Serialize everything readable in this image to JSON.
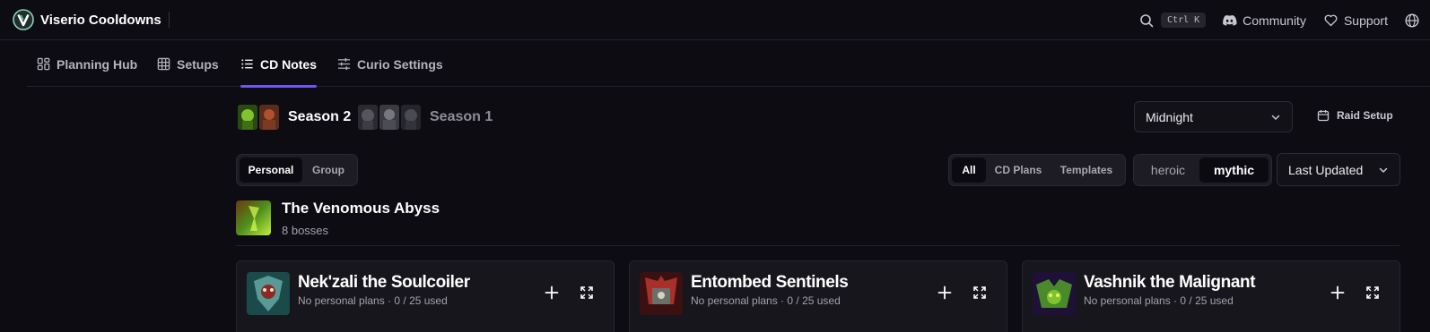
{
  "app": {
    "name": "Viserio Cooldowns",
    "search_shortcut": "Ctrl K",
    "links": [
      {
        "label": "Community",
        "icon": "discord-icon"
      },
      {
        "label": "Support",
        "icon": "heart-icon"
      }
    ],
    "language_icon": "globe-icon",
    "accent": "#6d57f0"
  },
  "nav": {
    "tabs": [
      {
        "label": "Planning Hub",
        "icon": "dashboard-icon",
        "active": false
      },
      {
        "label": "Setups",
        "icon": "grid-icon",
        "active": false
      },
      {
        "label": "CD Notes",
        "icon": "list-icon",
        "active": true
      },
      {
        "label": "Curio Settings",
        "icon": "sliders-icon",
        "active": false
      }
    ]
  },
  "seasons": [
    {
      "label": "Season 2",
      "active": true
    },
    {
      "label": "Season 1",
      "active": false
    }
  ],
  "expansion_select": {
    "value": "Midnight"
  },
  "raid_setup": {
    "label": "Raid Setup",
    "icon": "calendar-icon"
  },
  "filters": {
    "scope": {
      "options": [
        "Personal",
        "Group"
      ],
      "selected": "Personal"
    },
    "type": {
      "options": [
        "All",
        "CD Plans",
        "Templates"
      ],
      "selected": "All"
    },
    "difficulty": {
      "options": [
        "heroic",
        "mythic"
      ],
      "selected": "mythic"
    },
    "sort": {
      "value": "Last Updated"
    }
  },
  "raid": {
    "name": "The Venomous Abyss",
    "boss_count": "8 bosses"
  },
  "bosses": [
    {
      "name": "Nek'zali the Soulcoiler",
      "info": "No personal plans · 0 / 25 used"
    },
    {
      "name": "Entombed Sentinels",
      "info": "No personal plans · 0 / 25 used"
    },
    {
      "name": "Vashnik the Malignant",
      "info": "No personal plans · 0 / 25 used"
    }
  ]
}
